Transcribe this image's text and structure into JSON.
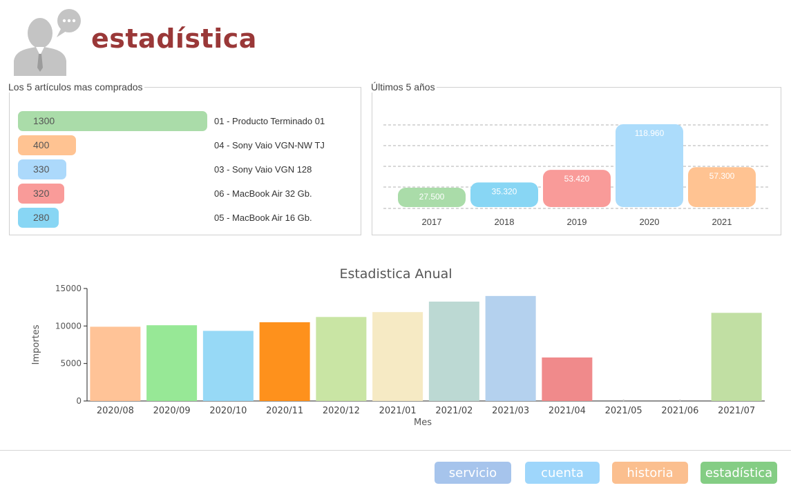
{
  "header": {
    "title": "estadística"
  },
  "top_articles": {
    "legend": "Los 5 artículos mas comprados",
    "max": 1300,
    "items": [
      {
        "value": "1300",
        "label": "01 - Producto Terminado 01",
        "color": "#aadca9"
      },
      {
        "value": "400",
        "label": "04 - Sony Vaio VGN-NW TJ",
        "color": "#ffc392"
      },
      {
        "value": "330",
        "label": "03 - Sony Vaio VGN 128",
        "color": "#acd9fb"
      },
      {
        "value": "320",
        "label": "06 - MacBook Air 32 Gb.",
        "color": "#f99b99"
      },
      {
        "value": "280",
        "label": "05 - MacBook Air 16 Gb.",
        "color": "#88d6f4"
      }
    ]
  },
  "last_years": {
    "legend": "Últimos 5 años",
    "years": [
      {
        "year": "2017",
        "label": "27.500",
        "value": 27500,
        "color": "#aadca9"
      },
      {
        "year": "2018",
        "label": "35.320",
        "value": 35320,
        "color": "#88d6f4"
      },
      {
        "year": "2019",
        "label": "53.420",
        "value": 53420,
        "color": "#f99b99"
      },
      {
        "year": "2020",
        "label": "118.960",
        "value": 118960,
        "color": "#acdcfb"
      },
      {
        "year": "2021",
        "label": "57.300",
        "value": 57300,
        "color": "#ffc392"
      }
    ]
  },
  "chart_data": {
    "type": "bar",
    "title": "Estadistica Anual",
    "xlabel": "Mes",
    "ylabel": "Importes",
    "ylim": [
      0,
      15000
    ],
    "yticks": [
      "0",
      "5000",
      "10000",
      "15000"
    ],
    "grid": false,
    "categories": [
      "2020/08",
      "2020/09",
      "2020/10",
      "2020/11",
      "2020/12",
      "2021/01",
      "2021/02",
      "2021/03",
      "2021/04",
      "2021/05",
      "2021/06",
      "2021/07"
    ],
    "values": [
      9900,
      10100,
      9350,
      10500,
      11200,
      11850,
      13250,
      14000,
      5800,
      0,
      0,
      11750
    ],
    "colors": [
      "#ffc397",
      "#97e896",
      "#97d9f6",
      "#fe911c",
      "#c9e5a4",
      "#f6eac4",
      "#bcd9d3",
      "#b4d1ee",
      "#f08a8b",
      "#cccccc",
      "#cccccc",
      "#c1dfa3"
    ]
  },
  "nav": {
    "buttons": [
      {
        "label": "servicio",
        "color": "#a6c4ec"
      },
      {
        "label": "cuenta",
        "color": "#9ed6fb"
      },
      {
        "label": "historia",
        "color": "#fbbf8f"
      },
      {
        "label": "estadística",
        "color": "#84cd84"
      }
    ]
  }
}
